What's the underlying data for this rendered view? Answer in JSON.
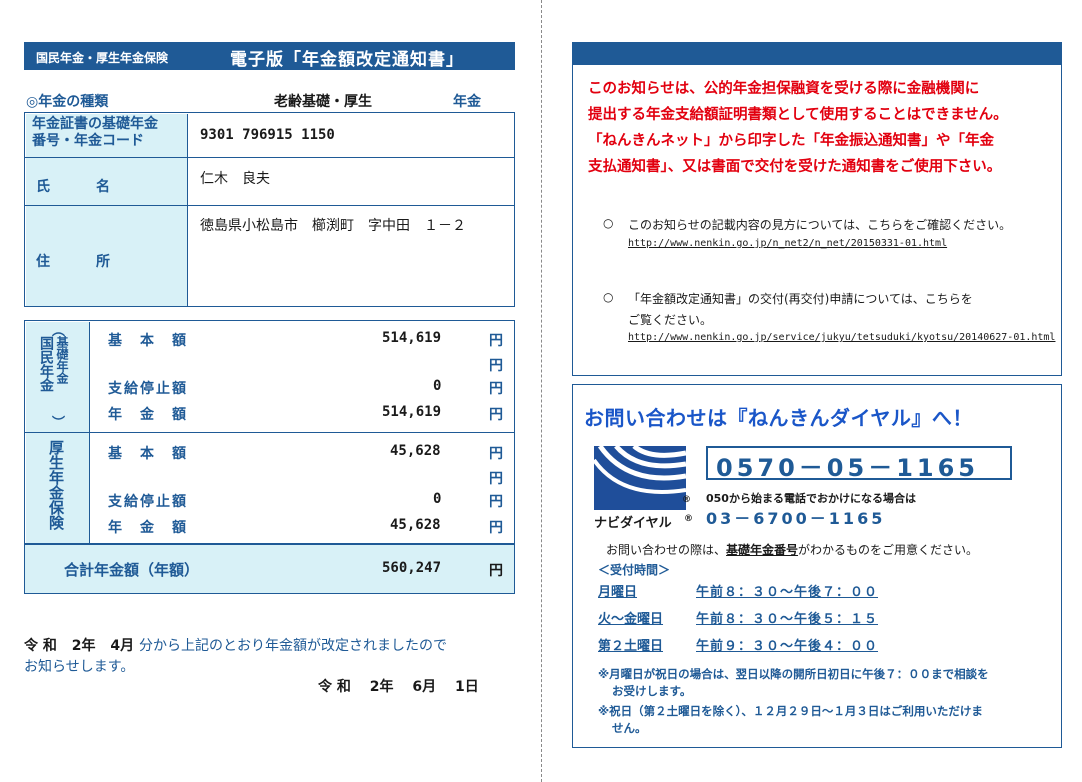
{
  "header": {
    "small": "国民年金・厚生年金保険",
    "title": "電子版「年金額改定通知書」"
  },
  "kind": {
    "label": "◎年金の種類",
    "value": "老齢基礎・厚生",
    "suffix": "年金"
  },
  "info": {
    "cert_label_1": "年金証書の基礎年金",
    "cert_label_2": "番号・年金コード",
    "cert_value": "9301 796915 1150",
    "name_label": "氏　名",
    "name_value": "仁木　良夫",
    "addr_label": "住　所",
    "addr_value": "徳島県小松島市　櫛渕町　字中田　１－２"
  },
  "kokumin": {
    "side_paren_top": "︵",
    "side_label_1": "国民年金",
    "side_label_2": "基礎年金",
    "side_paren_bottom": "︶",
    "rows": [
      {
        "label": "基　本　額",
        "amount": "514,619",
        "yen": "円"
      },
      {
        "label": "",
        "amount": "",
        "yen": "円"
      },
      {
        "label": "支給停止額",
        "amount": "0",
        "yen": "円"
      },
      {
        "label": "年　金　額",
        "amount": "514,619",
        "yen": "円"
      }
    ]
  },
  "kousei": {
    "side_label": "厚生年金保険",
    "rows": [
      {
        "label": "基　本　額",
        "amount": "45,628",
        "yen": "円"
      },
      {
        "label": "",
        "amount": "",
        "yen": "円"
      },
      {
        "label": "支給停止額",
        "amount": "0",
        "yen": "円"
      },
      {
        "label": "年　金　額",
        "amount": "45,628",
        "yen": "円"
      }
    ]
  },
  "total": {
    "label": "合計年金額（年額）",
    "amount": "560,247",
    "yen": "円"
  },
  "notice": {
    "era_1": "令 和",
    "year_1": "2年",
    "month_1": "4月",
    "text_1": "分から上記のとおり年金額が改定されましたので",
    "text_2": "お知らせします。",
    "date": "令 和　 2年　 6月　 1日"
  },
  "right_notice": {
    "red_lines": [
      "このお知らせは、公的年金担保融資を受ける際に金融機関に",
      "提出する年金支給額証明書類として使用することはできません。",
      "「ねんきんネット」から印字した「年金振込通知書」や「年金",
      "支払通知書」、又は書面で交付を受けた通知書をご使用下さい。"
    ],
    "bullet": "○",
    "item1_text": "このお知らせの記載内容の見方については、こちらをご確認ください。",
    "item1_url": "http://www.nenkin.go.jp/n_net2/n_net/20150331-01.html",
    "item2_text_1": "「年金額改定通知書」の交付(再交付)申請については、こちらを",
    "item2_text_2": "ご覧ください。",
    "item2_url": "http://www.nenkin.go.jp/service/jukyu/tetsuduki/kyotsu/20140627-01.html"
  },
  "contact": {
    "title": "お問い合わせは『ねんきんダイヤル』へ！",
    "logo_text": "ナビダイヤル",
    "logo_reg": "®",
    "phone": "0570－05－1165",
    "alt_note": "050から始まる電話でおかけになる場合は",
    "alt_phone": "03－6700－1165",
    "prep_pre": "お問い合わせの際は、",
    "prep_em": "基礎年金番号",
    "prep_post": "がわかるものをご用意ください。",
    "hours_title": "＜受付時間＞",
    "hours": [
      {
        "day": "月曜日",
        "time": "午前８：３０～午後７：００"
      },
      {
        "day": "火～金曜日",
        "time": "午前８：３０～午後５：１５"
      },
      {
        "day": "第２土曜日",
        "time": "午前９：３０～午後４：００"
      }
    ],
    "note1_a": "※月曜日が祝日の場合は、翌日以降の開所日初日に午後７：００まで相談を",
    "note1_b": "お受けします。",
    "note2_a": "※祝日（第２土曜日を除く）、１２月２９日～１月３日はご利用いただけま",
    "note2_b": "せん。"
  },
  "colors": {
    "brand_blue": "#1f5a96",
    "label_bg": "#d8f1f7",
    "warning_red": "#e2000f"
  }
}
